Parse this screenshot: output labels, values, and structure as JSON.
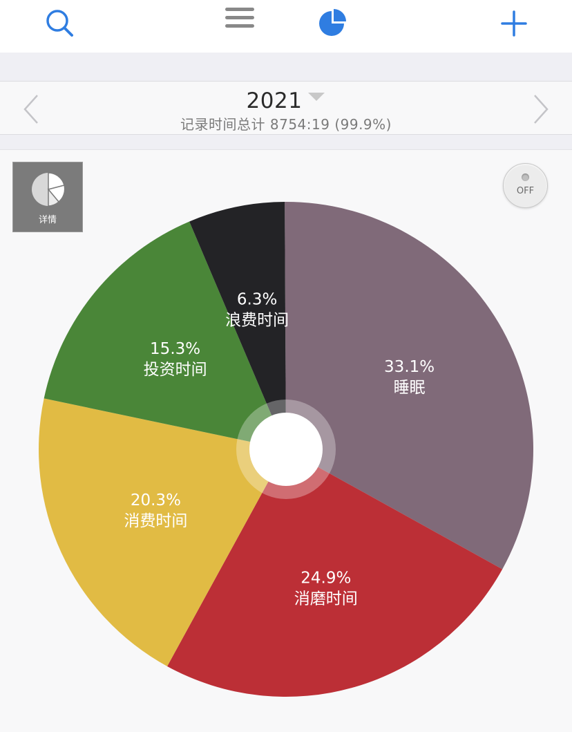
{
  "toolbar": {
    "icons": [
      "search-icon",
      "menu-icon",
      "pie-chart-icon",
      "plus-icon"
    ],
    "accent": "#2f7de1"
  },
  "header": {
    "year": "2021",
    "summary": "记录时间总计 8754:19 (99.9%)"
  },
  "detail_button": {
    "label": "详情"
  },
  "toggle": {
    "label": "OFF"
  },
  "chart_data": {
    "type": "pie",
    "series": [
      {
        "name": "睡眠",
        "percent": "33.1%",
        "value": 33.1,
        "color": "#806a79"
      },
      {
        "name": "消磨时间",
        "percent": "24.9%",
        "value": 24.9,
        "color": "#bc2f36"
      },
      {
        "name": "消费时间",
        "percent": "20.3%",
        "value": 20.3,
        "color": "#e1bb44"
      },
      {
        "name": "投资时间",
        "percent": "15.3%",
        "value": 15.3,
        "color": "#4a8638"
      },
      {
        "name": "浪费时间",
        "percent": "6.3%",
        "value": 6.3,
        "color": "#232326"
      }
    ],
    "legend": "none"
  }
}
